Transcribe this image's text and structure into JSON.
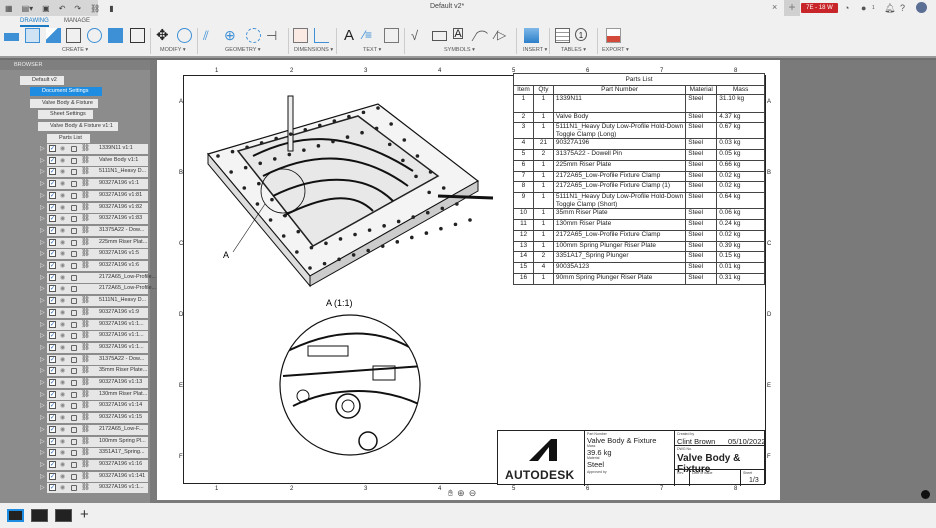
{
  "window": {
    "title": "Default v2*",
    "close": "×",
    "new_tab": "+",
    "badge": "7E - 18 W",
    "notifications": "1"
  },
  "ribbon": {
    "tabs": [
      "DRAWING",
      "MANAGE"
    ],
    "groups": [
      "CREATE ▾",
      "MODIFY ▾",
      "GEOMETRY ▾",
      "DIMENSIONS ▾",
      "TEXT ▾",
      "SYMBOLS ▾",
      "INSERT ▾",
      "TABLES ▾",
      "EXPORT ▾"
    ]
  },
  "browser": {
    "title": "BROWSER",
    "root": "Default v2",
    "doc_settings": "Document Settings",
    "sheet": "Valve Body & Fixture",
    "sheet_settings": "Sheet Settings",
    "view": "Valve Body & Fixture v1:1",
    "parts_list": "Parts List",
    "components": [
      "1339N11 v1:1",
      "Valve Body v1:1",
      "5111N1_Heavy D...",
      "90327A196 v1:1",
      "90327A196 v1:81",
      "90327A196 v1:82",
      "90327A196 v1:83",
      "31375A22 - Dow...",
      "225mm Riser Plat...",
      "90327A196 v1:5",
      "90327A196 v1:6",
      "2172A65_Low-Profile...",
      "2172A65_Low-Profile...",
      "5111N1_Heavy D...",
      "90327A196 v1:9",
      "90327A196 v1:1...",
      "90327A196 v1:1...",
      "90327A196 v1:1...",
      "31375A22 - Dow...",
      "35mm Riser Plate...",
      "90327A196 v1:13",
      "130mm Riser Plat...",
      "90327A196 v1:14",
      "90327A196 v1:15",
      "2172A65_Low-F...",
      "100mm Spring Pl...",
      "3351A17_Spring...",
      "90327A196 v1:16",
      "90327A196 v1:141",
      "90327A196 v1:1..."
    ]
  },
  "sheet": {
    "zones_x": [
      "1",
      "2",
      "3",
      "4",
      "5",
      "6",
      "7",
      "8"
    ],
    "zones_y": [
      "A",
      "B",
      "C",
      "D",
      "E",
      "F"
    ],
    "callout": "A",
    "detail_label": "A (1:1)"
  },
  "parts_list": {
    "title": "Parts List",
    "headers": [
      "Item",
      "Qty",
      "Part Number",
      "Material",
      "Mass"
    ],
    "rows": [
      [
        "1",
        "1",
        "1339N11",
        "Steel",
        "31.10 kg"
      ],
      [
        "2",
        "1",
        "Valve Body",
        "Steel",
        "4.37 kg"
      ],
      [
        "3",
        "1",
        "5111N1_Heavy Duty Low-Profile Hold-Down Toggle Clamp (Long)",
        "Steel",
        "0.67 kg"
      ],
      [
        "4",
        "21",
        "90327A196",
        "Steel",
        "0.03 kg"
      ],
      [
        "5",
        "2",
        "31375A22 - Dowell Pin",
        "Steel",
        "0.05 kg"
      ],
      [
        "6",
        "1",
        "225mm Riser Plate",
        "Steel",
        "0.66 kg"
      ],
      [
        "7",
        "1",
        "2172A65_Low-Profile Fixture Clamp",
        "Steel",
        "0.02 kg"
      ],
      [
        "8",
        "1",
        "2172A65_Low-Profile Fixture Clamp (1)",
        "Steel",
        "0.02 kg"
      ],
      [
        "9",
        "1",
        "5111N1_Heavy Duty Low-Profile Hold-Down Toggle Clamp (Short)",
        "Steel",
        "0.64 kg"
      ],
      [
        "10",
        "1",
        "35mm Riser Plate",
        "Steel",
        "0.06 kg"
      ],
      [
        "11",
        "1",
        "130mm Riser Plate",
        "Steel",
        "0.24 kg"
      ],
      [
        "12",
        "1",
        "2172A65_Low-Profile Fixture Clamp",
        "Steel",
        "0.02 kg"
      ],
      [
        "13",
        "1",
        "100mm Spring Plunger Riser Plate",
        "Steel",
        "0.39 kg"
      ],
      [
        "14",
        "2",
        "3351A17_Spring Plunger",
        "Steel",
        "0.15 kg"
      ],
      [
        "15",
        "4",
        "90035A123",
        "Steel",
        "0.01 kg"
      ],
      [
        "16",
        "1",
        "90mm Spring Plunger Riser Plate",
        "Steel",
        "0.31 kg"
      ]
    ]
  },
  "title_block": {
    "logo": "AUTODESK",
    "part_number_label": "Part Number",
    "part_number": "Valve Body & Fixture",
    "mass_label": "Mass",
    "mass": "39.6 kg",
    "material_label": "Material",
    "material": "Steel",
    "approved_label": "Approved by",
    "created_label": "Created by",
    "created_by": "Clint Brown",
    "date": "05/10/2022",
    "dwg_label": "DWG No.",
    "dwg_no": "Valve Body & Fixture",
    "rev_label": "Rev.",
    "issue_label": "Date of issue",
    "sheet_label": "Sheet",
    "sheet": "1/3"
  },
  "colors": {
    "accent": "#1e8ce0",
    "badge": "#c8252a"
  }
}
